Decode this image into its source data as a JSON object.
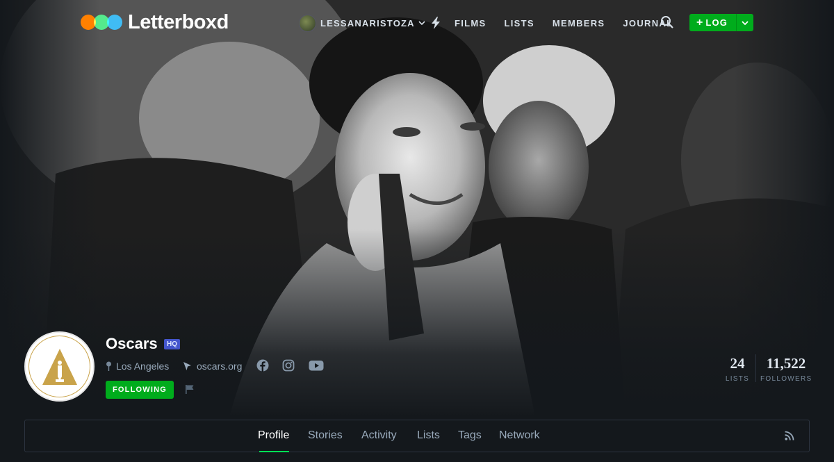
{
  "brand": {
    "name": "Letterboxd",
    "dot_colors": [
      "#ff8000",
      "#00e054",
      "#40bcf4"
    ]
  },
  "header": {
    "username": "LESSANARISTOZA",
    "nav": [
      "FILMS",
      "LISTS",
      "MEMBERS",
      "JOURNAL"
    ],
    "log_label": "LOG",
    "icons": [
      "activity-bolt-icon",
      "search-icon",
      "plus-icon",
      "chevron-down-icon"
    ]
  },
  "profile": {
    "name": "Oscars",
    "badge": "HQ",
    "location": "Los Angeles",
    "website": "oscars.org",
    "social_icons": [
      "facebook-icon",
      "instagram-icon",
      "youtube-icon"
    ],
    "follow_label": "FOLLOWING"
  },
  "stats": [
    {
      "value": "24",
      "label": "LISTS"
    },
    {
      "value": "11,522",
      "label": "FOLLOWERS"
    }
  ],
  "tabs": {
    "items": [
      "Profile",
      "Stories",
      "Activity",
      "Lists",
      "Tags",
      "Network"
    ],
    "active": "Profile"
  },
  "colors": {
    "accent_green": "#00ac1c",
    "tab_active_underline": "#00e054",
    "background": "#14181c",
    "badge": "#4455cc"
  }
}
